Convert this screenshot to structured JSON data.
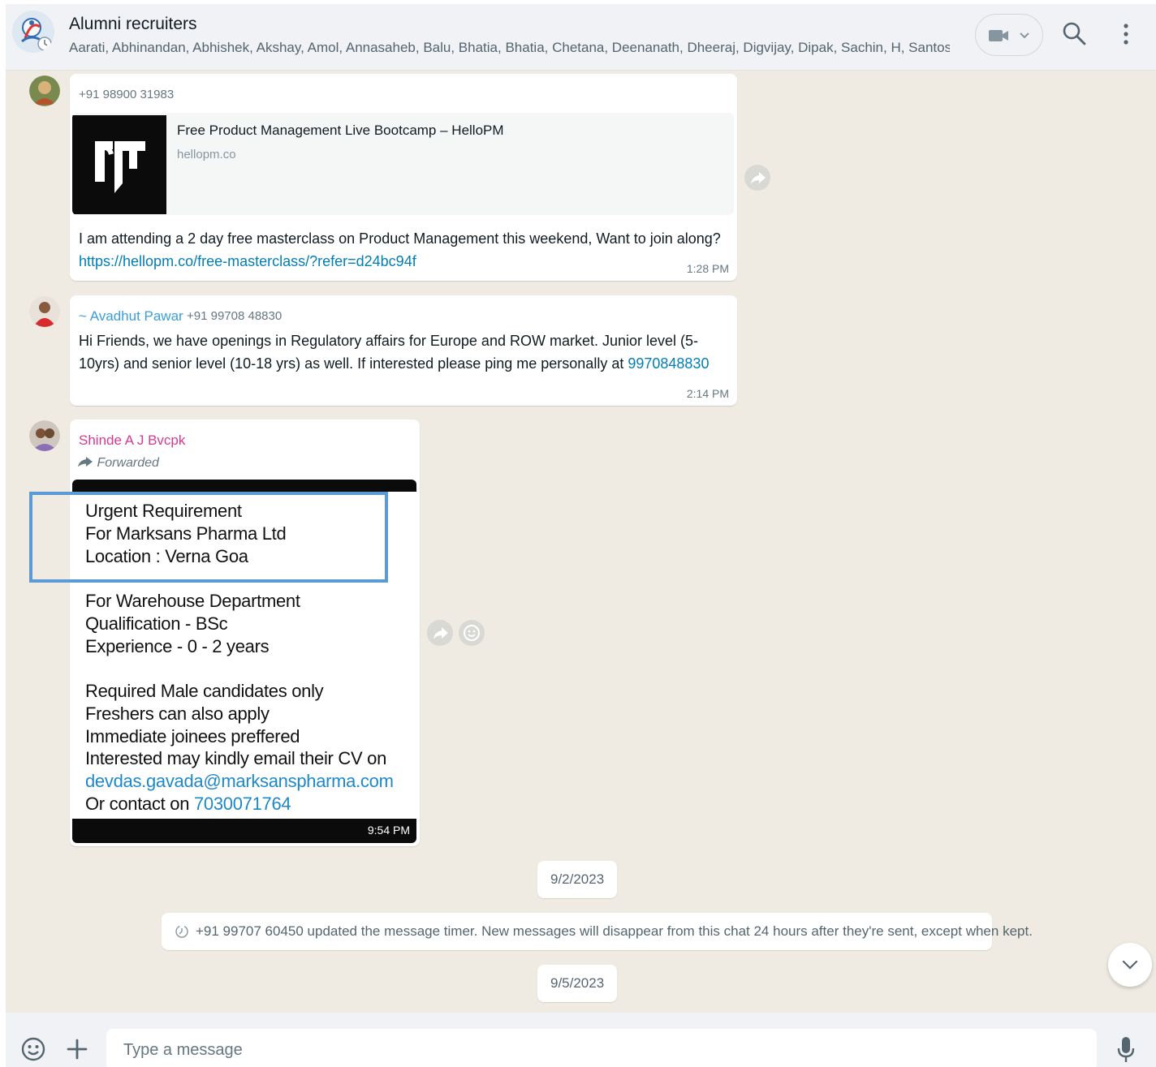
{
  "header": {
    "title": "Alumni recruiters",
    "members": "Aarati, Abhinandan, Abhishek, Akshay, Amol, Annasaheb, Balu, Bhatia, Bhatia, Chetana, Deenanath, Dheeraj, Digvijay, Dipak, Sachin, H, Santosh, ...",
    "icons": [
      "group-avatar",
      "video-call-icon",
      "chevron-down-icon",
      "search-icon",
      "more-options-icon"
    ]
  },
  "messages": [
    {
      "sender_phone": "+91 98900 31983",
      "link_preview": {
        "title": "Free Product Management Live Bootcamp – HelloPM",
        "domain": "hellopm.co"
      },
      "text": "I am attending a 2 day free masterclass on Product Management this weekend, Want to join along?",
      "link": "https://hellopm.co/free-masterclass/?refer=d24bc94f",
      "time": "1:28 PM"
    },
    {
      "sender_name": "~ Avadhut Pawar",
      "sender_phone": "+91 99708 48830",
      "text_line1": "Hi Friends, we have openings in Regulatory affairs for Europe and ROW market.  Junior level (5-",
      "text_line2": "10yrs) and senior level (10-18 yrs) as well. If interested please ping me personally at",
      "phone_link": "9970848830",
      "time": "2:14 PM"
    },
    {
      "sender_name": "Shinde A J Bvcpk",
      "forwarded_label": "Forwarded",
      "image_lines": [
        "Urgent Requirement",
        "For Marksans Pharma Ltd",
        "Location : Verna Goa",
        "For Warehouse Department",
        "Qualification - BSc",
        "Experience - 0 - 2 years",
        "Required Male candidates only",
        "Freshers can also apply",
        "Immediate joinees preffered",
        "Interested may kindly email their CV on"
      ],
      "image_email": "devdas.gavada@marksanspharma.com",
      "image_contact_prefix": "Or contact on",
      "image_contact_number": "7030071764",
      "time": "9:54 PM"
    }
  ],
  "dates": [
    "9/2/2023",
    "9/5/2023"
  ],
  "system_message": "+91 99707 60450 updated the message timer. New messages will disappear from this chat 24 hours after they're sent, except when kept.",
  "composer": {
    "placeholder": "Type a message"
  },
  "colors": {
    "chat_background": "#efeae2",
    "header_background": "#f0f2f5",
    "link": "#027eb5",
    "sender_avadhut": "#3a9fd8",
    "sender_shinde": "#d63a8e",
    "highlight_box": "#5b9bd5"
  }
}
